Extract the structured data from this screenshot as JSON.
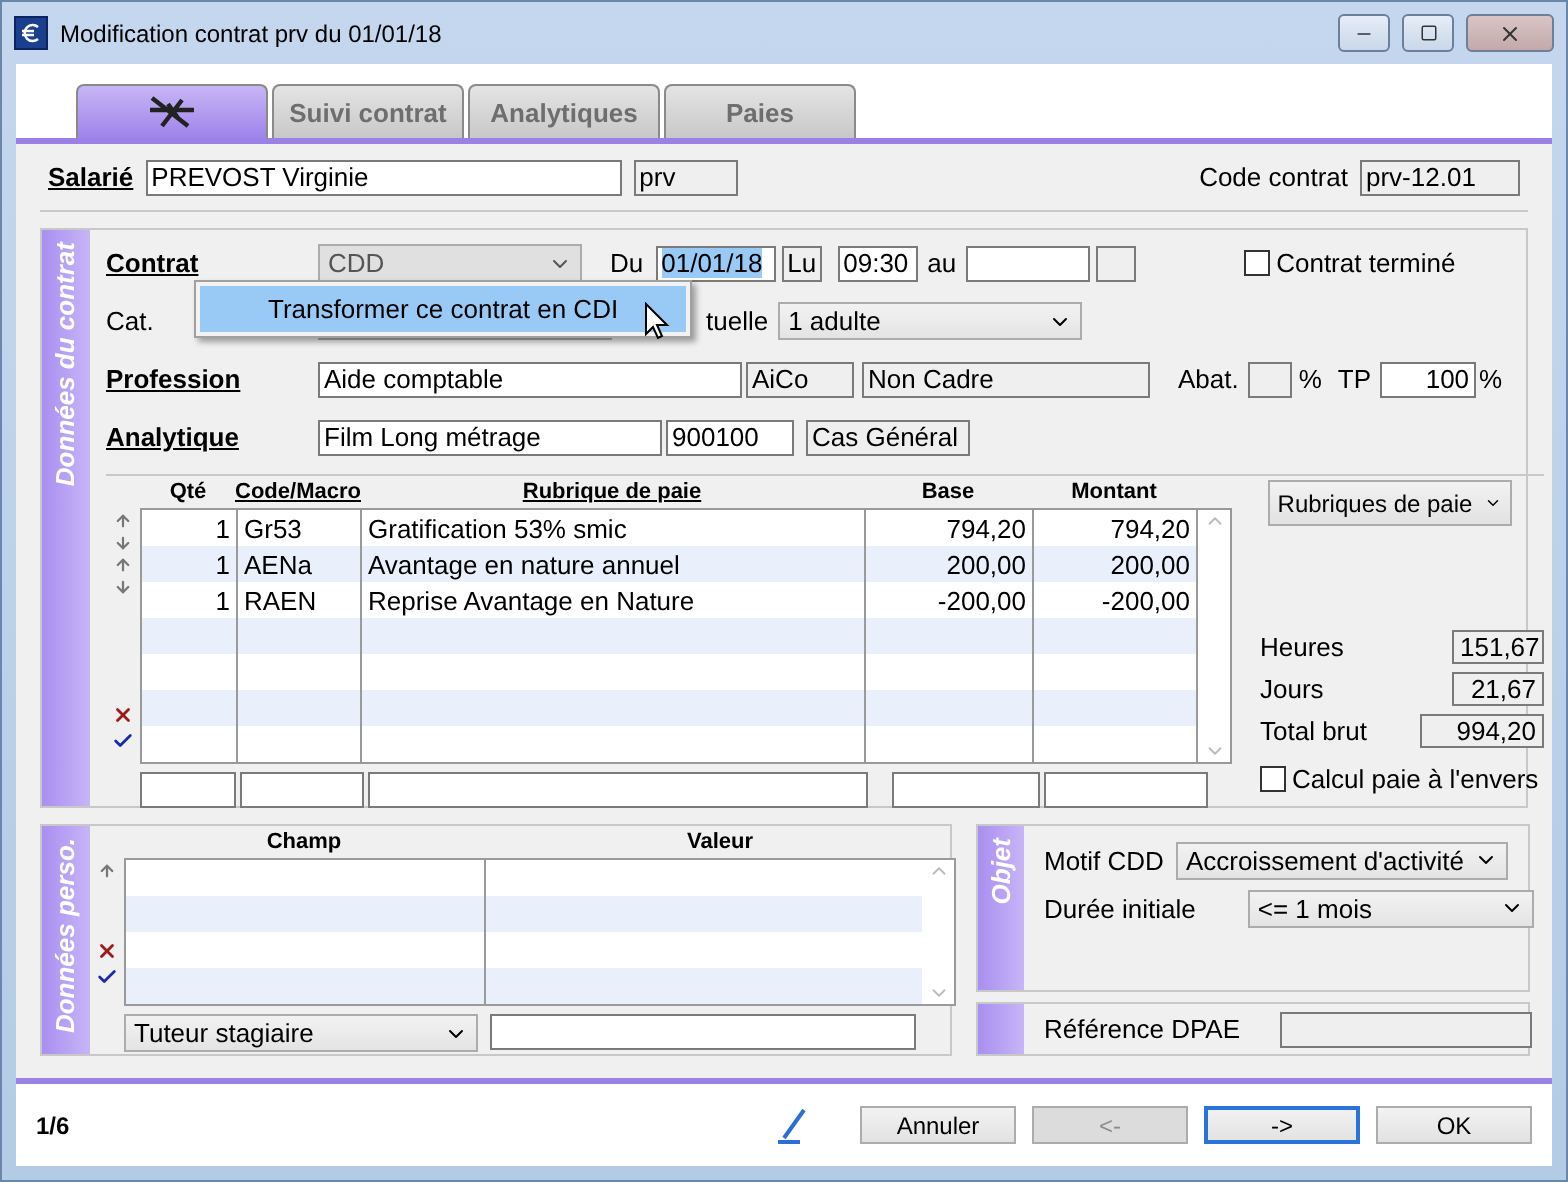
{
  "window": {
    "title": "Modification contrat prv du 01/01/18"
  },
  "tabs": [
    {
      "kind": "icon",
      "selected": true
    },
    {
      "kind": "text",
      "label": "Suivi contrat",
      "selected": false
    },
    {
      "kind": "text",
      "label": "Analytiques",
      "selected": false
    },
    {
      "kind": "text",
      "label": "Paies",
      "selected": false
    }
  ],
  "employee": {
    "label": "Salarié",
    "name": "PREVOST Virginie",
    "code": "prv"
  },
  "contract_code": {
    "label": "Code contrat",
    "value": "prv-12.01"
  },
  "contract_section": {
    "title": "Données du contrat",
    "contrat": {
      "label": "Contrat",
      "value": "CDD",
      "disabled": true
    },
    "start": {
      "label": "Du",
      "date": "01/01/18",
      "day": "Lu",
      "time": "09:30"
    },
    "end": {
      "label": "au"
    },
    "terminated": {
      "label": "Contrat terminé",
      "checked": false
    },
    "category": {
      "label": "Cat."
    },
    "convention": {
      "label": "tuelle",
      "value": "1 adulte"
    },
    "profession": {
      "label": "Profession",
      "value": "Aide comptable",
      "code": "AiCo",
      "status": "Non Cadre"
    },
    "abat": {
      "label": "Abat.",
      "unit": "%"
    },
    "tp": {
      "label": "TP",
      "value": "100",
      "unit": "%"
    },
    "analytique": {
      "label": "Analytique",
      "value": "Film Long métrage",
      "code": "900100",
      "case": "Cas Général"
    },
    "table": {
      "columns": [
        {
          "label": "Qté",
          "underlined": false
        },
        {
          "label": "Code/Macro",
          "underlined": true
        },
        {
          "label": "Rubrique de paie",
          "underlined": true
        },
        {
          "label": "Base",
          "underlined": false
        },
        {
          "label": "Montant",
          "underlined": false
        }
      ],
      "rows": [
        [
          "1",
          "Gr53",
          "Gratification 53% smic",
          "794,20",
          "794,20"
        ],
        [
          "1",
          "AENa",
          "Avantage en nature annuel",
          "200,00",
          "200,00"
        ],
        [
          "1",
          "RAEN",
          "Reprise Avantage en Nature",
          "-200,00",
          "-200,00"
        ]
      ]
    },
    "rubriques_button": "Rubriques de paie",
    "totals": [
      {
        "label": "Heures",
        "value": "151,67"
      },
      {
        "label": "Jours",
        "value": "21,67"
      },
      {
        "label": "Total brut",
        "value": "994,20"
      }
    ],
    "reverse_calc": {
      "label": "Calcul paie à l'envers",
      "checked": false
    }
  },
  "context_menu": {
    "items": [
      {
        "label": "Transformer ce contrat en CDI",
        "selected": true
      }
    ]
  },
  "perso_section": {
    "title": "Données perso.",
    "columns": [
      "Champ",
      "Valeur"
    ],
    "field": "Tuteur stagiaire"
  },
  "objet_section": {
    "title": "Objet",
    "motif": {
      "label": "Motif CDD",
      "value": "Accroissement d'activité"
    },
    "duration": {
      "label": "Durée initiale",
      "value": "<= 1 mois"
    }
  },
  "dpae": {
    "label": "Référence DPAE"
  },
  "footer": {
    "page": "1/6",
    "buttons": [
      {
        "label": "Annuler",
        "disabled": false,
        "focused": false
      },
      {
        "label": "<-",
        "disabled": true,
        "focused": false
      },
      {
        "label": "->",
        "disabled": false,
        "focused": true
      },
      {
        "label": "OK",
        "disabled": false,
        "focused": false
      }
    ]
  }
}
